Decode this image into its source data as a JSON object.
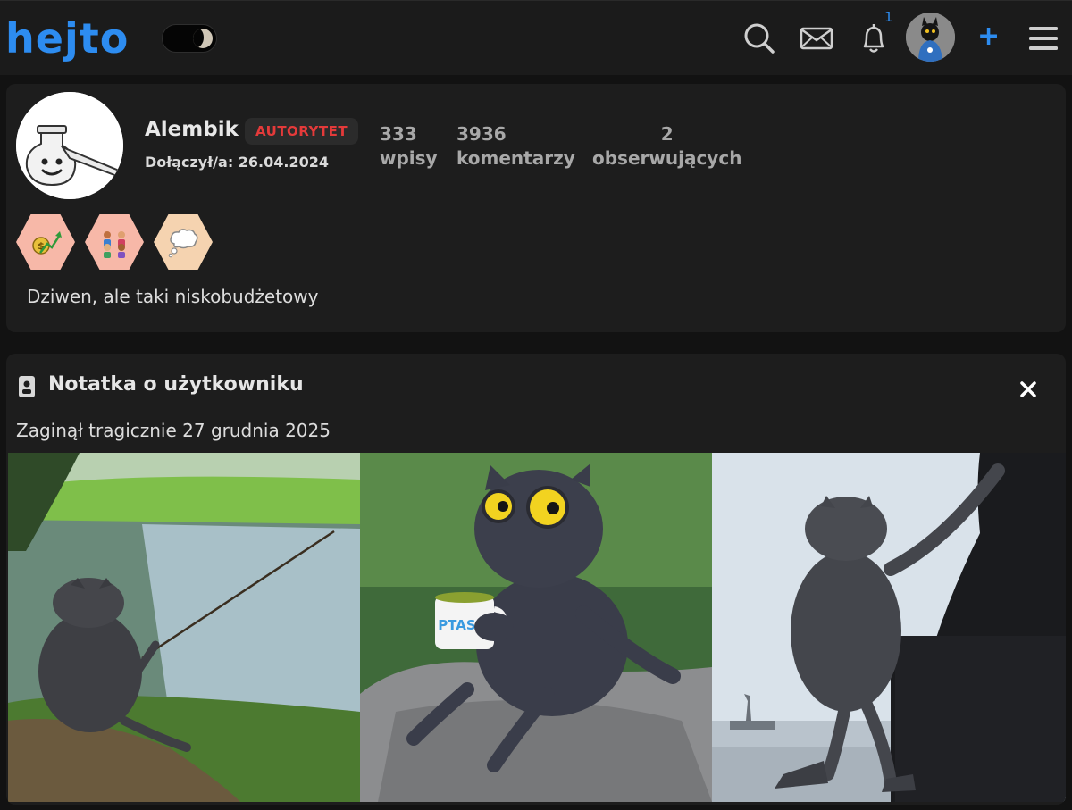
{
  "header": {
    "logo_text": "hejto",
    "notification_count": "1",
    "add_label": "+",
    "icons": [
      "moon-toggle-icon",
      "search-icon",
      "mail-icon",
      "bell-icon",
      "avatar",
      "plus-icon",
      "menu-icon"
    ],
    "accent_color": "#2d8cf0"
  },
  "profile": {
    "username": "Alembik",
    "rank": "AUTORYTET",
    "joined": "Dołączył/a: 26.04.2024",
    "stats": [
      {
        "value": "333",
        "label": "wpisy"
      },
      {
        "value": "3936",
        "label": "komentarzy"
      },
      {
        "value": "2",
        "label": "obserwujących"
      }
    ],
    "badges": [
      "money-growth-badge",
      "community-badge",
      "thought-bubble-badge"
    ],
    "bio": "Dziwen, ale taki niskobudżetowy"
  },
  "note": {
    "title": "Notatka o użytkowniku",
    "text": "Zaginął tragicznie 27 grudnia 2025",
    "mug_text": "PTASIX",
    "photos": [
      "owl-fishing-photo",
      "owl-with-mug-photo",
      "owl-statue-of-liberty-photo"
    ]
  }
}
